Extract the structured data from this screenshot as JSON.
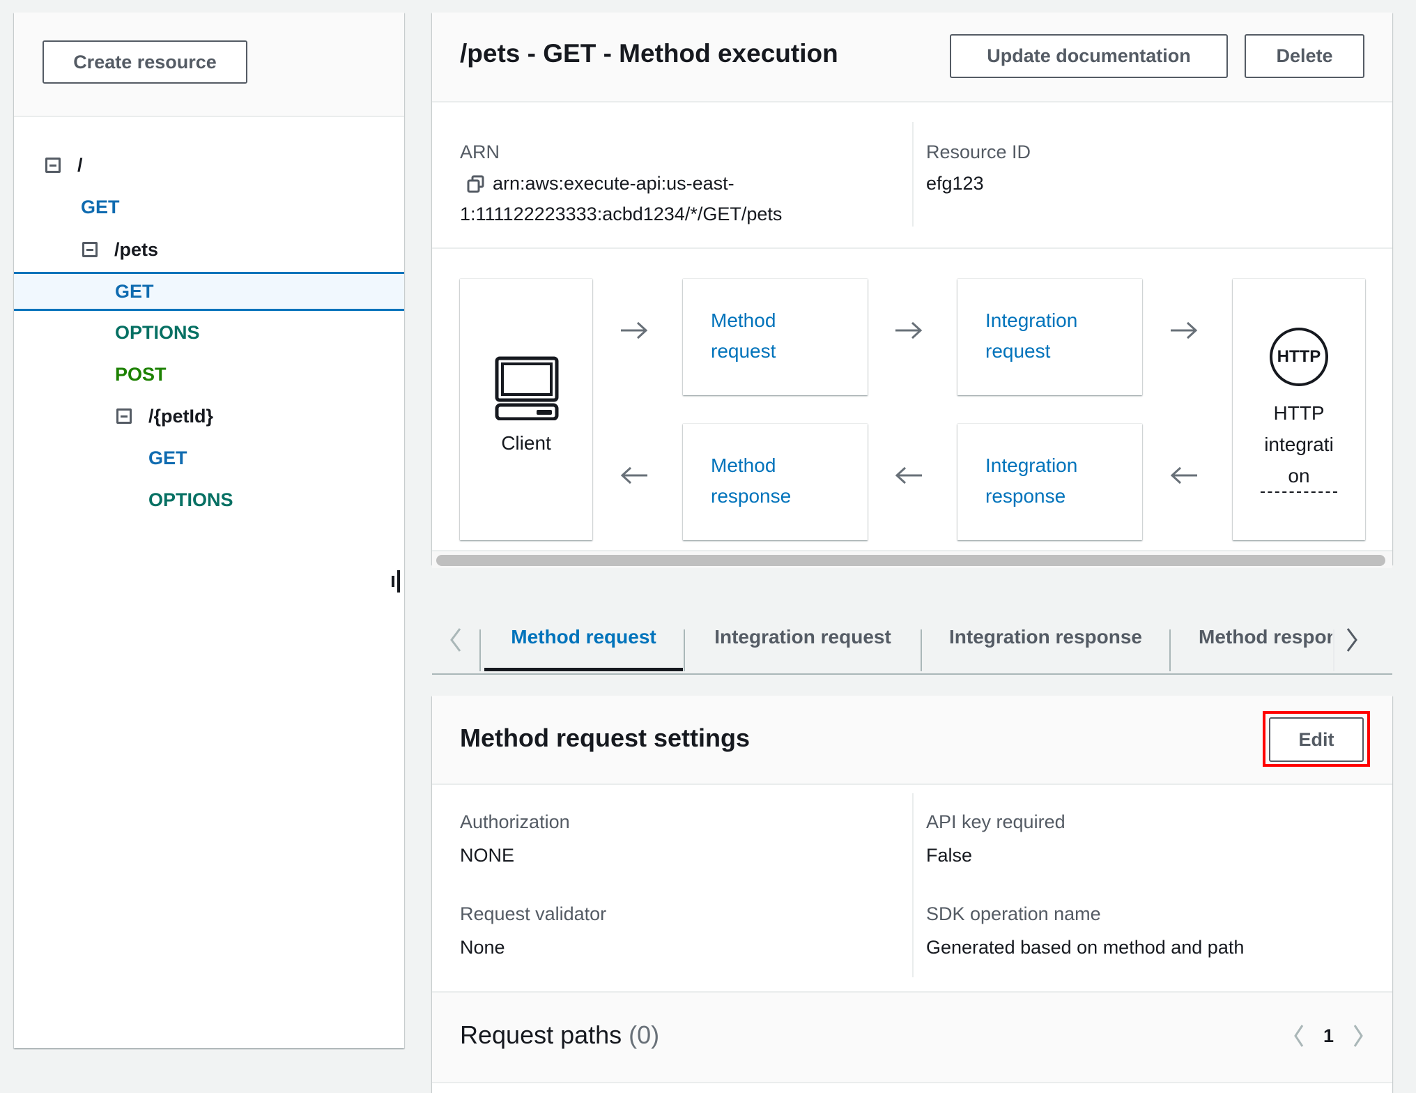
{
  "sidebar": {
    "create_resource_label": "Create resource",
    "tree": [
      {
        "label": "/",
        "kind": "path",
        "collapsible": true
      },
      {
        "label": "GET",
        "kind": "method-get"
      },
      {
        "label": "/pets",
        "kind": "path",
        "collapsible": true
      },
      {
        "label": "GET",
        "kind": "method-get",
        "selected": true
      },
      {
        "label": "OPTIONS",
        "kind": "method-options"
      },
      {
        "label": "POST",
        "kind": "method-post"
      },
      {
        "label": "/{petId}",
        "kind": "path",
        "collapsible": true
      },
      {
        "label": "GET",
        "kind": "method-get"
      },
      {
        "label": "OPTIONS",
        "kind": "method-options"
      }
    ]
  },
  "header": {
    "title": "/pets - GET - Method execution",
    "update_documentation_label": "Update documentation",
    "delete_label": "Delete"
  },
  "details": {
    "arn_label": "ARN",
    "arn_line1": "arn:aws:execute-api:us-east-",
    "arn_line2": "1:111122223333:acbd1234/*/GET/pets",
    "resource_id_label": "Resource ID",
    "resource_id_value": "efg123"
  },
  "diagram": {
    "client_label": "Client",
    "method_request": [
      "Method",
      "request"
    ],
    "integration_request": [
      "Integration",
      "request"
    ],
    "method_response": [
      "Method",
      "response"
    ],
    "integration_response": [
      "Integration",
      "response"
    ],
    "http_badge": "HTTP",
    "http_label": [
      "HTTP",
      "integrati",
      "on"
    ]
  },
  "tabs": {
    "items": [
      "Method request",
      "Integration request",
      "Integration response",
      "Method respons"
    ],
    "active_index": 0
  },
  "settings": {
    "title": "Method request settings",
    "edit_label": "Edit",
    "fields": {
      "authorization_label": "Authorization",
      "authorization_value": "NONE",
      "api_key_label": "API key required",
      "api_key_value": "False",
      "validator_label": "Request validator",
      "validator_value": "None",
      "sdk_label": "SDK operation name",
      "sdk_value": "Generated based on method and path"
    }
  },
  "request_paths": {
    "title": "Request paths",
    "count": "(0)",
    "page": "1"
  },
  "colors": {
    "get": "#0f6bb0",
    "options": "#067063",
    "post": "#1d8102",
    "link": "#0073bb",
    "highlight": "#ff0000"
  }
}
